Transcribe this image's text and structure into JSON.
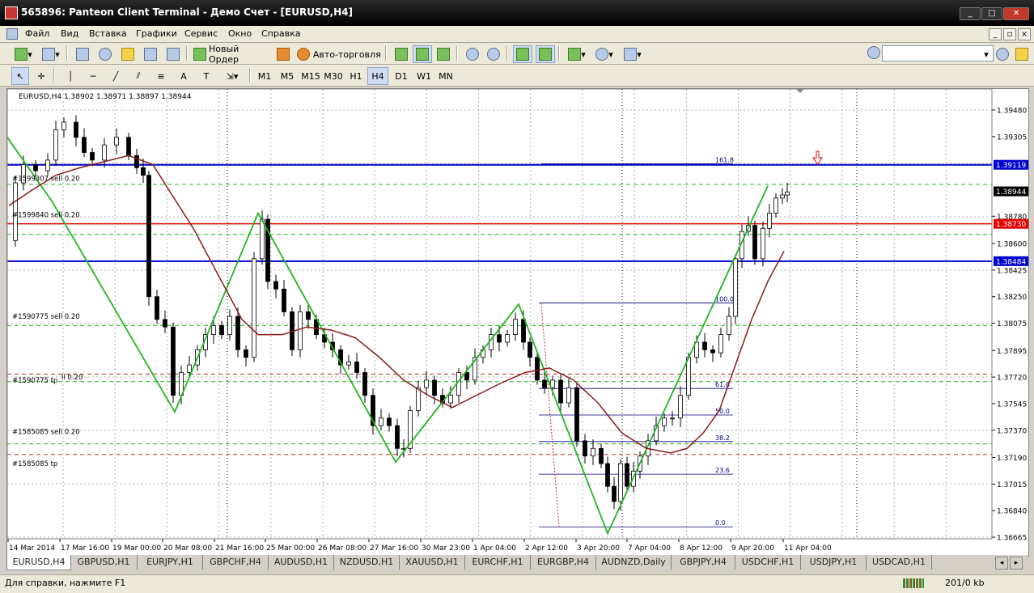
{
  "window": {
    "title": "565896: Panteon Client Terminal - Демо Счет - [EURUSD,H4]",
    "minimize": "_",
    "maximize": "□",
    "close": "✕"
  },
  "menu": [
    "Файл",
    "Вид",
    "Вставка",
    "Графики",
    "Сервис",
    "Окно",
    "Справка"
  ],
  "toolbar": {
    "new_order": "Новый Ордер",
    "auto_trading": "Авто-торговля"
  },
  "timeframes": [
    "M1",
    "M5",
    "M15",
    "M30",
    "H1",
    "H4",
    "D1",
    "W1",
    "MN"
  ],
  "active_timeframe": "H4",
  "chart": {
    "header": "EURUSD,H4  1.38902 1.38971 1.38897 1.38944",
    "price_labels": [
      "1.39480",
      "1.39305",
      "1.39119",
      "1.38944",
      "1.38780",
      "1.38730",
      "1.38600",
      "1.38484",
      "1.38425",
      "1.38250",
      "1.38075",
      "1.37895",
      "1.37720",
      "1.37545",
      "1.37370",
      "1.37190",
      "1.37015",
      "1.36840",
      "1.36665"
    ],
    "time_labels": [
      "14 Mar 2014",
      "17 Mar 16:00",
      "19 Mar 00:00",
      "20 Mar 08:00",
      "21 Mar 16:00",
      "25 Mar 00:00",
      "26 Mar 08:00",
      "27 Mar 16:00",
      "30 Mar 23:00",
      "1 Apr 04:00",
      "2 Apr 12:00",
      "3 Apr 20:00",
      "7 Apr 04:00",
      "8 Apr 12:00",
      "9 Apr 20:00",
      "11 Apr 04:00"
    ],
    "order_labels": [
      "#1599307 sell 0.20",
      "#1599840 sell 0.20",
      "#1590775 sell 0.20",
      "#1590775 tp",
      "ll 0.20",
      "#1585085 sell 0.20",
      "#1585085 tp"
    ],
    "fib_levels": [
      "161.8",
      "100.0",
      "61.8",
      "50.0",
      "38.2",
      "23.6",
      "0.0"
    ],
    "colors": {
      "blue_line": "#0000cc",
      "red_line": "#e00000",
      "zigzag": "#22b522",
      "ma": "#8b1a1a",
      "grid": "#b0b0b0"
    }
  },
  "tabs": [
    "EURUSD,H4",
    "GBPUSD,H1",
    "EURJPY,H1",
    "GBPCHF,H4",
    "AUDUSD,H1",
    "NZDUSD,H1",
    "XAUUSD,H1",
    "EURCHF,H1",
    "EURGBP,H4",
    "AUDNZD,Daily",
    "GBPJPY,H4",
    "USDCHF,H1",
    "USDJPY,H1",
    "USDCAD,H1"
  ],
  "status": {
    "help": "Для справки, нажмите F1",
    "traffic": "201/0 kb"
  }
}
